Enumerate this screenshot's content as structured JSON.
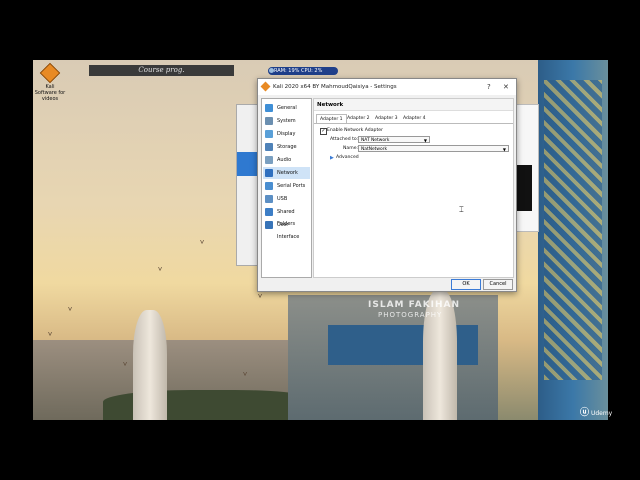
{
  "desktop": {
    "icon_label": "Kali Software\nfor videos",
    "course_bar": "Course prog.",
    "ram_label": "RAM: 19%  CPU: 2%",
    "watermark_main": "ISLAM FAKIHAN",
    "watermark_sub": "PHOTOGRAPHY",
    "udemy": "Udemy"
  },
  "dialog": {
    "title": "Kali 2020 x64 BY MahmoudQaisiya - Settings",
    "help": "?",
    "close": "✕",
    "nav": [
      {
        "label": "General",
        "icon": "general-icon"
      },
      {
        "label": "System",
        "icon": "system-icon"
      },
      {
        "label": "Display",
        "icon": "display-icon"
      },
      {
        "label": "Storage",
        "icon": "storage-icon"
      },
      {
        "label": "Audio",
        "icon": "audio-icon"
      },
      {
        "label": "Network",
        "icon": "network-icon"
      },
      {
        "label": "Serial Ports",
        "icon": "serial-ports-icon"
      },
      {
        "label": "USB",
        "icon": "usb-icon"
      },
      {
        "label": "Shared Folders",
        "icon": "shared-folders-icon"
      },
      {
        "label": "User Interface",
        "icon": "user-interface-icon"
      }
    ],
    "active_nav": "Network",
    "panel_title": "Network",
    "tabs": [
      "Adapter 1",
      "Adapter 2",
      "Adapter 3",
      "Adapter 4"
    ],
    "active_tab": "Adapter 1",
    "enable_label": "Enable Network Adapter",
    "enable_checked": "✓",
    "attached_label": "Attached to:",
    "attached_value": "NAT Network",
    "name_label": "Name:",
    "name_value": "NatNetwork",
    "advanced_label": "Advanced",
    "ok": "OK",
    "cancel": "Cancel"
  }
}
